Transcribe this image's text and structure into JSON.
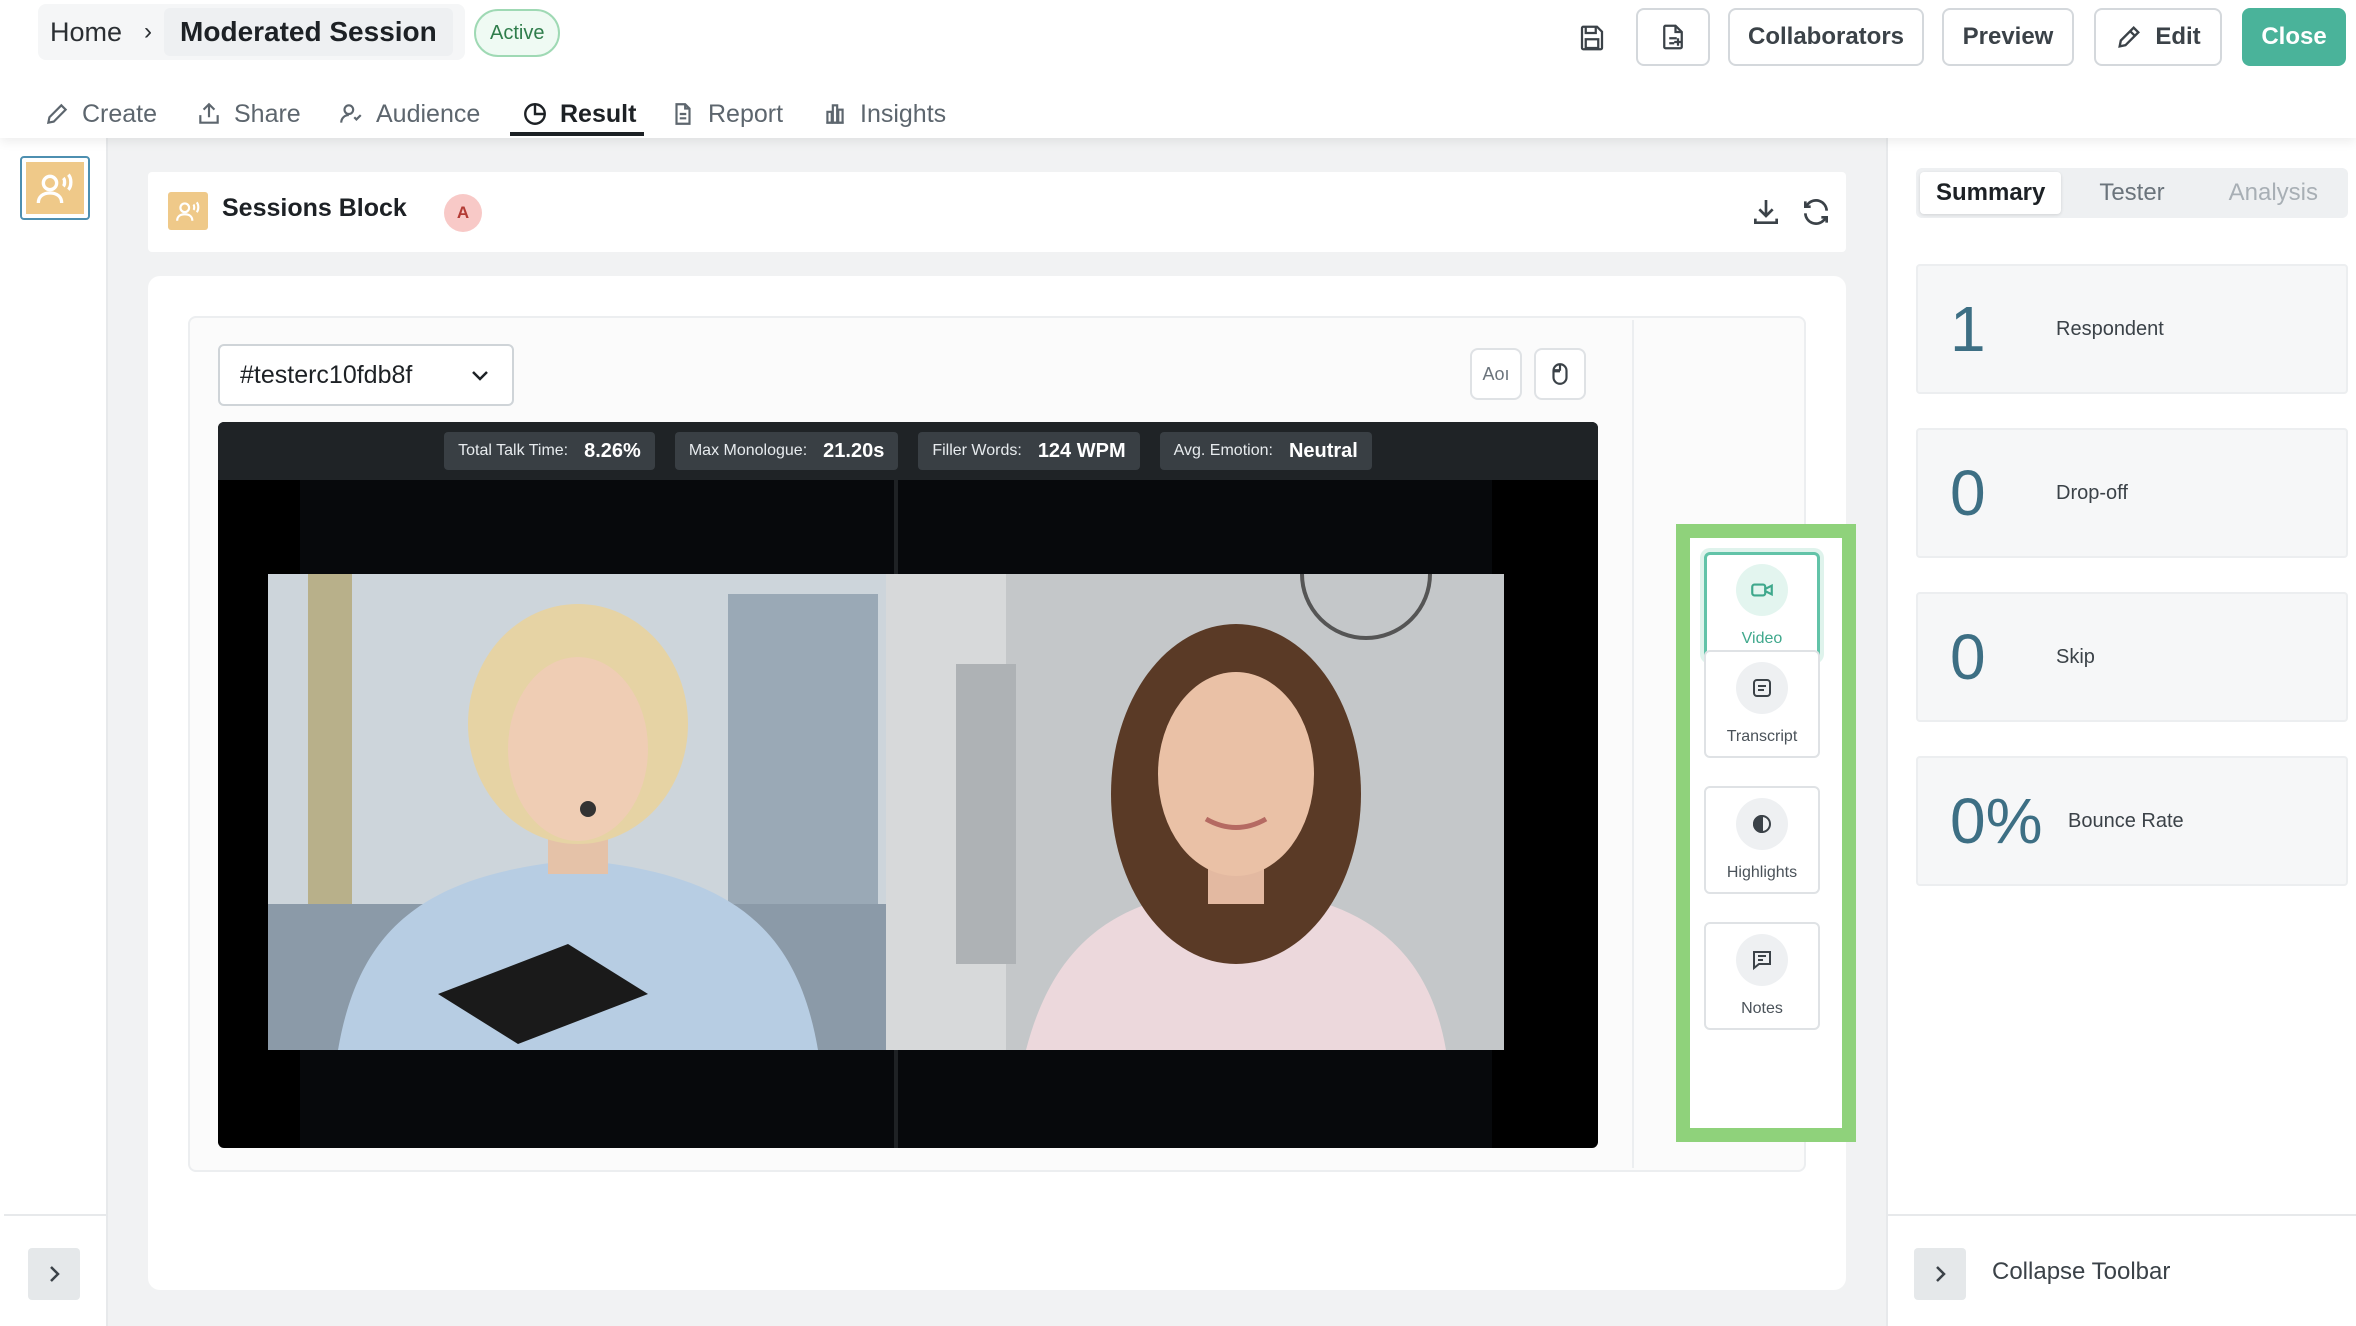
{
  "header": {
    "breadcrumb_home": "Home",
    "breadcrumb_separator": "›",
    "title": "Moderated Session",
    "status": "Active",
    "buttons": {
      "collaborators": "Collaborators",
      "preview": "Preview",
      "edit": "Edit",
      "close": "Close"
    },
    "accent_color": "#4ab39a"
  },
  "tabs": [
    {
      "label": "Create",
      "icon": "pencil-icon"
    },
    {
      "label": "Share",
      "icon": "share-icon"
    },
    {
      "label": "Audience",
      "icon": "audience-icon"
    },
    {
      "label": "Result",
      "icon": "pie-chart-icon",
      "active": true
    },
    {
      "label": "Report",
      "icon": "document-icon"
    },
    {
      "label": "Insights",
      "icon": "insights-icon"
    }
  ],
  "block": {
    "title": "Sessions Block",
    "avatar_initial": "A"
  },
  "session": {
    "tester_id": "#testerc10fdb8f",
    "aoi_label": "Aoı",
    "stats": [
      {
        "label": "Total Talk Time:",
        "value": "8.26%"
      },
      {
        "label": "Max Monologue:",
        "value": "21.20s"
      },
      {
        "label": "Filler Words:",
        "value": "124 WPM"
      },
      {
        "label": "Avg. Emotion:",
        "value": "Neutral"
      }
    ],
    "views": [
      {
        "label": "Video",
        "icon": "video-camera-icon",
        "active": true
      },
      {
        "label": "Transcript",
        "icon": "transcript-icon"
      },
      {
        "label": "Highlights",
        "icon": "highlights-icon"
      },
      {
        "label": "Notes",
        "icon": "notes-icon"
      }
    ],
    "highlight_color": "#8fd27b"
  },
  "sidebar": {
    "tabs": [
      "Summary",
      "Tester",
      "Analysis"
    ],
    "active_tab": "Summary",
    "metrics": [
      {
        "value": "1",
        "label": "Respondent"
      },
      {
        "value": "0",
        "label": "Drop-off"
      },
      {
        "value": "0",
        "label": "Skip"
      },
      {
        "value": "0%",
        "label": "Bounce Rate"
      }
    ],
    "collapse_label": "Collapse Toolbar"
  }
}
